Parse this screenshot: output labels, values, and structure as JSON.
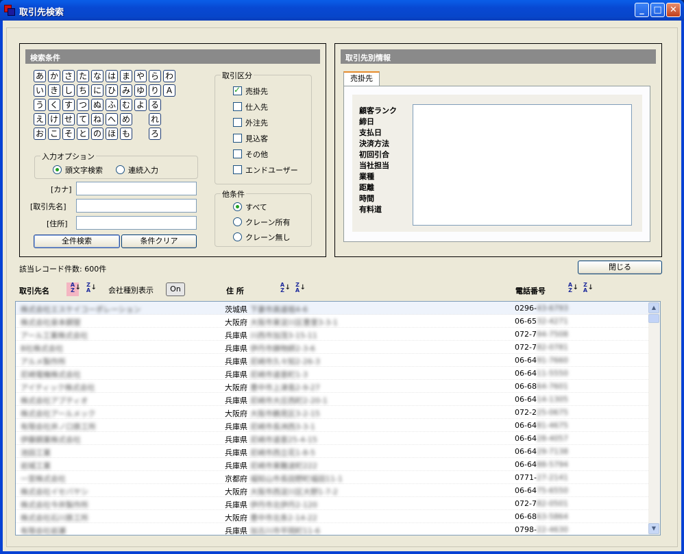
{
  "window": {
    "title": "取引先検索",
    "minimize": "_",
    "maximize": "□",
    "close": "✕"
  },
  "search": {
    "header": "検索条件",
    "kana": [
      [
        "あ",
        "か",
        "さ",
        "た",
        "な",
        "は",
        "ま",
        "や",
        "ら",
        "わ"
      ],
      [
        "い",
        "き",
        "し",
        "ち",
        "に",
        "ひ",
        "み",
        "ゆ",
        "り",
        "A"
      ],
      [
        "う",
        "く",
        "す",
        "つ",
        "ぬ",
        "ふ",
        "む",
        "よ",
        "る"
      ],
      [
        "え",
        "け",
        "せ",
        "て",
        "ね",
        "へ",
        "め",
        "",
        "れ"
      ],
      [
        "お",
        "こ",
        "そ",
        "と",
        "の",
        "ほ",
        "も",
        "",
        "ろ"
      ]
    ],
    "input_option": {
      "legend": "入力オプション",
      "opt1": "頭文字検索",
      "opt2": "連続入力"
    },
    "fields": {
      "kana_label": "[カナ]",
      "name_label": "[取引先名]",
      "address_label": "[住所]",
      "kana_value": "",
      "name_value": "",
      "address_value": ""
    },
    "buttons": {
      "search_all": "全件検索",
      "clear": "条件クリア"
    },
    "category": {
      "legend": "取引区分",
      "items": [
        {
          "label": "売掛先",
          "checked": true
        },
        {
          "label": "仕入先",
          "checked": false
        },
        {
          "label": "外注先",
          "checked": false
        },
        {
          "label": "見込客",
          "checked": false
        },
        {
          "label": "その他",
          "checked": false
        },
        {
          "label": "エンドユーザー",
          "checked": false
        }
      ]
    },
    "other": {
      "legend": "他条件",
      "items": [
        {
          "label": "すべて",
          "selected": true
        },
        {
          "label": "クレーン所有",
          "selected": false
        },
        {
          "label": "クレーン無し",
          "selected": false
        }
      ]
    }
  },
  "detail": {
    "header": "取引先別情報",
    "tab": "売掛先",
    "fields": [
      "顧客ランク",
      "締日",
      "支払日",
      "決済方法",
      "初回引合",
      "当社担当",
      "業種",
      "距離",
      "時間",
      "有料道"
    ]
  },
  "record_count": "該当レコード件数: 600件",
  "close_button": "閉じる",
  "columns": {
    "name": "取引先名",
    "company_type": "会社種別表示",
    "toggle": "On",
    "address": "住 所",
    "phone": "電話番号"
  },
  "sort_icons": {
    "asc": "A Z",
    "desc": "Z A"
  },
  "rows": [
    {
      "name": "株式会社エスケイコーポレーション",
      "pref": "茨城県",
      "addr": "下妻市高道祖4-6",
      "phone": "0296-",
      "phone2": "43-6793"
    },
    {
      "name": "株式会社泉本鋼管",
      "pref": "大阪府",
      "addr": "大阪市東淀川区豊里3-3-1",
      "phone": "06-65",
      "phone2": "32-4271"
    },
    {
      "name": "アール工業株式会社",
      "pref": "兵庫県",
      "addr": "川西市加茂3-15-11",
      "phone": "072-7",
      "phone2": "94-7508"
    },
    {
      "name": "B社株式会社",
      "pref": "兵庫県",
      "addr": "伊丹市鋳物師2-3-6",
      "phone": "072-7",
      "phone2": "82-0781"
    },
    {
      "name": "アルメ製作所",
      "pref": "兵庫県",
      "addr": "尼崎市久々知2-26-3",
      "phone": "06-64",
      "phone2": "91-7660"
    },
    {
      "name": "尼崎電機株式会社",
      "pref": "兵庫県",
      "addr": "尼崎市道意町1-3",
      "phone": "06-64",
      "phone2": "11-5550"
    },
    {
      "name": "アイティック株式会社",
      "pref": "大阪府",
      "addr": "豊中市上津島2-9-27",
      "phone": "06-68",
      "phone2": "64-7601"
    },
    {
      "name": "株式会社アブティオ",
      "pref": "兵庫県",
      "addr": "尼崎市大庄西町2-20-1",
      "phone": "06-64",
      "phone2": "14-1305"
    },
    {
      "name": "株式会社アールメック",
      "pref": "大阪府",
      "addr": "大阪市鶴見区3-2-15",
      "phone": "072-2",
      "phone2": "25-0675"
    },
    {
      "name": "有限会社井ノ口鉄工所",
      "pref": "兵庫県",
      "addr": "尼崎市長洲西3-3-1",
      "phone": "06-64",
      "phone2": "81-4675"
    },
    {
      "name": "伊藤鋼業株式会社",
      "pref": "兵庫県",
      "addr": "尼崎市道意25-4-15",
      "phone": "06-64",
      "phone2": "28-4057"
    },
    {
      "name": "池田工業",
      "pref": "兵庫県",
      "addr": "尼崎市西立花1-8-5",
      "phone": "06-64",
      "phone2": "29-7138"
    },
    {
      "name": "岩城工業",
      "pref": "兵庫県",
      "addr": "尼崎市東難波町222",
      "phone": "06-64",
      "phone2": "88-5794"
    },
    {
      "name": "一宮株式会社",
      "pref": "京都府",
      "addr": "福知山市長田野町福田11-1",
      "phone": "0771-",
      "phone2": "27-2141"
    },
    {
      "name": "株式会社イセバヤシ",
      "pref": "大阪府",
      "addr": "大阪市西淀川区大野1-7-2",
      "phone": "06-64",
      "phone2": "75-6550"
    },
    {
      "name": "株式会社今井製作所",
      "pref": "兵庫県",
      "addr": "伊丹市北伊丹2-120",
      "phone": "072-7",
      "phone2": "82-0501"
    },
    {
      "name": "株式会社石川鉄工所",
      "pref": "大阪府",
      "addr": "豊中市北条2-14-22",
      "phone": "06-68",
      "phone2": "63-5864"
    },
    {
      "name": "有限会社岩瀬",
      "pref": "兵庫県",
      "addr": "加古川市平岡町11-6",
      "phone": "0798-",
      "phone2": "22-4630"
    }
  ]
}
